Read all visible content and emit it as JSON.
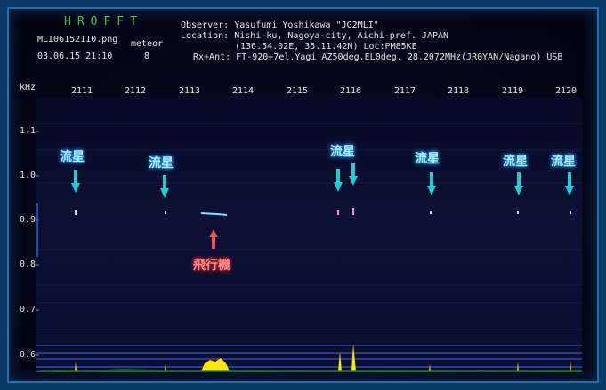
{
  "header": {
    "app_title": "HROFFT",
    "filename": "MLI06152110.png",
    "mode": "meteor",
    "datetime": "03.06.15 21:10",
    "count": "8",
    "observer_line": "Observer: Yasufumi Yoshikawa \"JG2MLI\"",
    "location_line": "Location: Nishi-ku, Nagoya-city, Aichi-pref. JAPAN",
    "coords_line": "(136.54.02E, 35.11.42N) Loc:PM85KE",
    "rx_line": "Rx+Ant: FT-920+7el.Yagi AZ50deg.EL0deg. 28.2072MHz(JR0YAN/Nagano) USB"
  },
  "axis": {
    "y_unit": "kHz",
    "time_ticks": [
      "2111",
      "2112",
      "2113",
      "2114",
      "2115",
      "2116",
      "2117",
      "2118",
      "2119",
      "2120"
    ],
    "freq_ticks": [
      "1.1",
      "1.0",
      "0.9",
      "0.8",
      "0.7",
      "0.6"
    ]
  },
  "annotations": {
    "meteor_labels": [
      "流星",
      "流星",
      "流星",
      "流星",
      "流星",
      "流星"
    ],
    "airplane_label": "飛行機"
  },
  "colors": {
    "title_green": "#31d04a",
    "meteor_label": "#aef0ff",
    "meteor_arrow": "#1ad0d0",
    "plane_label": "#ff8a8a",
    "plane_arrow": "#e05a5a",
    "signal_yellow": "#ffe600"
  }
}
